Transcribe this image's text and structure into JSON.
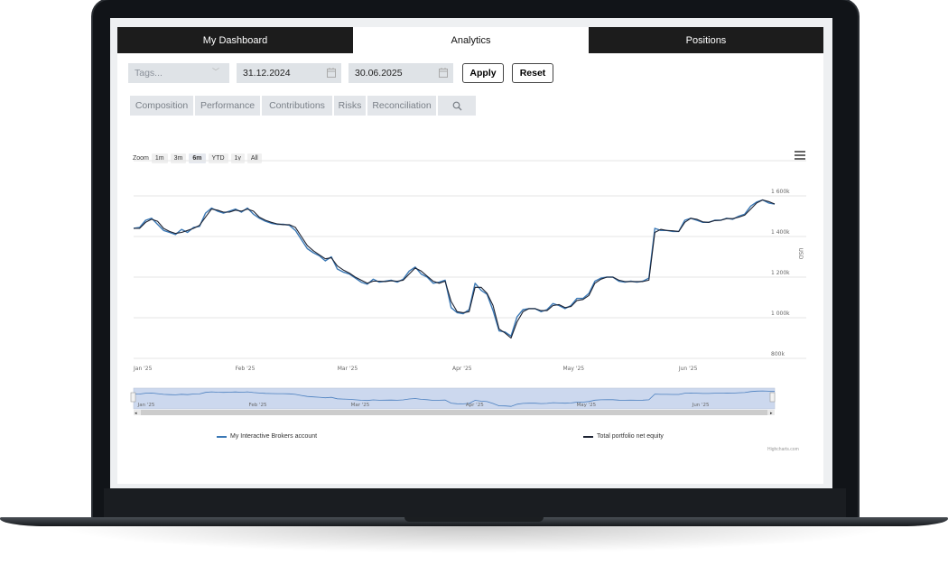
{
  "tabs": [
    {
      "label": "My Dashboard"
    },
    {
      "label": "Analytics",
      "active": true
    },
    {
      "label": "Positions"
    }
  ],
  "filters": {
    "tags_placeholder": "Tags...",
    "date_from": "31.12.2024",
    "date_to": "30.06.2025",
    "apply_label": "Apply",
    "reset_label": "Reset"
  },
  "subtabs": [
    "Composition",
    "Performance",
    "Contributions",
    "Risks",
    "Reconciliation"
  ],
  "zoom": {
    "label": "Zoom",
    "options": [
      "1m",
      "3m",
      "6m",
      "YTD",
      "1y",
      "All"
    ],
    "selected": "6m"
  },
  "chart_data": {
    "type": "line",
    "ylabel": "USD",
    "y_ticks": [
      "800k",
      "1 000k",
      "1 200k",
      "1 400k",
      "1 600k"
    ],
    "ylim": [
      800000,
      1600000
    ],
    "x_ticks": [
      "Jan '25",
      "Feb '25",
      "Mar '25",
      "Apr '25",
      "May '25",
      "Jun '25"
    ],
    "navigator_ticks": [
      "Jan '25",
      "Feb '25",
      "Mar '25",
      "Apr '25",
      "May '25",
      "Jun '25"
    ],
    "legend_position": "bottom",
    "series": [
      {
        "name": "My Interactive Brokers account",
        "color": "#3a78b5",
        "values": [
          1440000,
          1445000,
          1480000,
          1490000,
          1460000,
          1430000,
          1420000,
          1410000,
          1435000,
          1420000,
          1445000,
          1450000,
          1515000,
          1540000,
          1525000,
          1515000,
          1525000,
          1535000,
          1520000,
          1540000,
          1510000,
          1490000,
          1475000,
          1465000,
          1460000,
          1460000,
          1455000,
          1430000,
          1385000,
          1340000,
          1320000,
          1305000,
          1280000,
          1300000,
          1240000,
          1225000,
          1215000,
          1195000,
          1175000,
          1165000,
          1190000,
          1175000,
          1180000,
          1185000,
          1175000,
          1190000,
          1230000,
          1250000,
          1215000,
          1200000,
          1170000,
          1175000,
          1185000,
          1050000,
          1025000,
          1020000,
          1040000,
          1170000,
          1135000,
          1115000,
          1035000,
          935000,
          930000,
          910000,
          1005000,
          1040000,
          1045000,
          1045000,
          1030000,
          1040000,
          1070000,
          1060000,
          1045000,
          1060000,
          1095000,
          1095000,
          1120000,
          1180000,
          1195000,
          1200000,
          1200000,
          1180000,
          1175000,
          1180000,
          1175000,
          1180000,
          1195000,
          1440000,
          1430000,
          1430000,
          1425000,
          1425000,
          1480000,
          1490000,
          1480000,
          1470000,
          1470000,
          1480000,
          1480000,
          1490000,
          1485000,
          1500000,
          1510000,
          1550000,
          1570000,
          1580000,
          1565000,
          1560000
        ]
      },
      {
        "name": "Total portfolio net equity",
        "color": "#1d2333",
        "values": [
          1440000,
          1440000,
          1470000,
          1485000,
          1475000,
          1440000,
          1425000,
          1415000,
          1420000,
          1430000,
          1440000,
          1455000,
          1495000,
          1535000,
          1530000,
          1520000,
          1520000,
          1530000,
          1525000,
          1535000,
          1525000,
          1495000,
          1480000,
          1470000,
          1462000,
          1458000,
          1458000,
          1445000,
          1400000,
          1355000,
          1330000,
          1310000,
          1290000,
          1295000,
          1255000,
          1235000,
          1220000,
          1200000,
          1185000,
          1170000,
          1180000,
          1180000,
          1178000,
          1182000,
          1180000,
          1185000,
          1215000,
          1245000,
          1230000,
          1205000,
          1180000,
          1170000,
          1180000,
          1080000,
          1030000,
          1025000,
          1030000,
          1150000,
          1150000,
          1120000,
          1060000,
          945000,
          925000,
          900000,
          980000,
          1030000,
          1045000,
          1045000,
          1035000,
          1035000,
          1060000,
          1065000,
          1050000,
          1055000,
          1085000,
          1090000,
          1110000,
          1170000,
          1190000,
          1200000,
          1200000,
          1185000,
          1178000,
          1178000,
          1178000,
          1178000,
          1185000,
          1420000,
          1435000,
          1430000,
          1428000,
          1425000,
          1470000,
          1490000,
          1485000,
          1472000,
          1470000,
          1478000,
          1480000,
          1488000,
          1488000,
          1495000,
          1505000,
          1535000,
          1565000,
          1580000,
          1572000,
          1560000
        ]
      }
    ]
  },
  "credit": "Highcharts.com"
}
